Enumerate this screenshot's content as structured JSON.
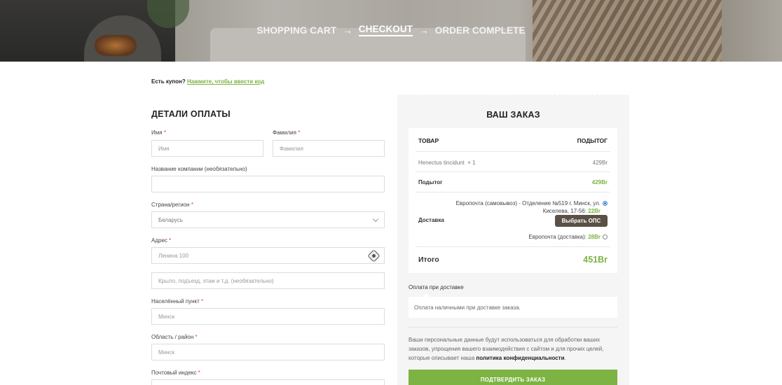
{
  "hero": {
    "step1": "SHOPPING CART",
    "arrow1": "→",
    "step2": "CHECKOUT",
    "arrow2": "→",
    "step3": "ORDER COMPLETE"
  },
  "coupon": {
    "text": "Есть купон?",
    "link": "Нажмите, чтобы ввести код"
  },
  "billing": {
    "title": "ДЕТАЛИ ОПЛАТЫ",
    "first_name": {
      "label": "Имя",
      "placeholder": "Имя"
    },
    "last_name": {
      "label": "Фамилия",
      "placeholder": "Фамилия"
    },
    "company": {
      "label": "Название компании (необязательно)",
      "placeholder": ""
    },
    "country": {
      "label": "Страна/регион",
      "value": "Беларусь"
    },
    "address": {
      "label": "Адрес",
      "placeholder": "Ленина 100"
    },
    "address2": {
      "placeholder": "Крыло, подъезд, этаж и т.д. (необязательно)"
    },
    "city": {
      "label": "Населённый пункт",
      "value": "Минск"
    },
    "region": {
      "label": "Область / район",
      "value": "Минск"
    },
    "postcode": {
      "label": "Почтовый индекс"
    },
    "required_mark": "*"
  },
  "order": {
    "title": "ВАШ ЗАКАЗ",
    "col_product": "ТОВАР",
    "col_subtotal": "ПОДЫТОГ",
    "item_name": "Henectus tincidunt",
    "item_qty": "× 1",
    "item_price": "429Br",
    "subtotal_label": "Подытог",
    "subtotal_value": "429Br",
    "shipping_label": "Доставка",
    "ship_option1_line1": "Европочта (самовывоз) - Отделение №519 г. Минск, ул.",
    "ship_option1_line2": "Киселева, 17-56:",
    "ship_option1_price": "22Br",
    "ship_button": "Выбрать ОПС",
    "ship_option2": "Европочта (доставка):",
    "ship_option2_price": "28Br",
    "total_label": "Итого",
    "total_value": "451Br"
  },
  "payment": {
    "method": "Оплата при доставке",
    "description": "Оплата наличными при доставке заказа."
  },
  "privacy": {
    "text": "Ваши персональные данные будут использоваться для обработки ваших заказов, упрощения вашего взаимодействия с сайтом и для прочих целей, которые описывает наша",
    "link": "политика конфиденциальности",
    "end": "."
  },
  "confirm_button": "ПОДТВЕРДИТЬ ЗАКАЗ",
  "colors": {
    "accent": "#7cb342",
    "button_dark": "#5b5045",
    "required": "#e23b3b"
  }
}
